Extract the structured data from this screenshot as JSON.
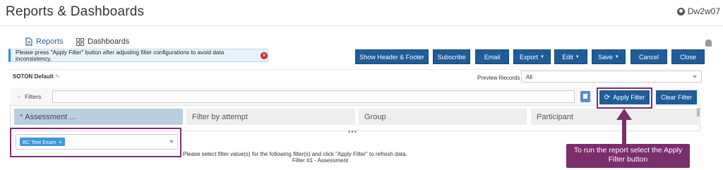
{
  "header": {
    "title": "Reports & Dashboards",
    "user": "Dw2w07"
  },
  "tabs": [
    {
      "label": "Reports"
    },
    {
      "label": "Dashboards"
    }
  ],
  "alert": {
    "message": "Please press \"Apply Filter\" button after adjusting filter configurations to avoid data inconsistency."
  },
  "toolbar": {
    "show_header_footer": "Show Header & Footer",
    "subscribe": "Subscribe",
    "email": "Email",
    "export": "Export",
    "edit": "Edit",
    "save": "Save",
    "cancel": "Cancel",
    "close": "Close"
  },
  "report": {
    "name": "SOTON Default"
  },
  "preview": {
    "label": "Preview Records",
    "value": "All"
  },
  "filters": {
    "label": "Filters",
    "apply": "Apply Filter",
    "clear": "Clear Filter",
    "columns": [
      {
        "label": "Assessment ...",
        "required": true
      },
      {
        "label": "Filter by attempt"
      },
      {
        "label": "Group"
      },
      {
        "label": "Participant"
      }
    ],
    "selected_chip": "BC Test Exam",
    "dots": "•••"
  },
  "info": {
    "line1": "Please select filter value(s) for the following filter(s) and click \"Apply Filter\" to refresh data.",
    "line2": "Filter #1 - Assessment"
  },
  "callout": {
    "text": "To run the report select the Apply Filter button"
  },
  "colors": {
    "primary": "#1f5c99",
    "callout": "#7b2e6c",
    "alert_bg": "#e8f3fb"
  }
}
